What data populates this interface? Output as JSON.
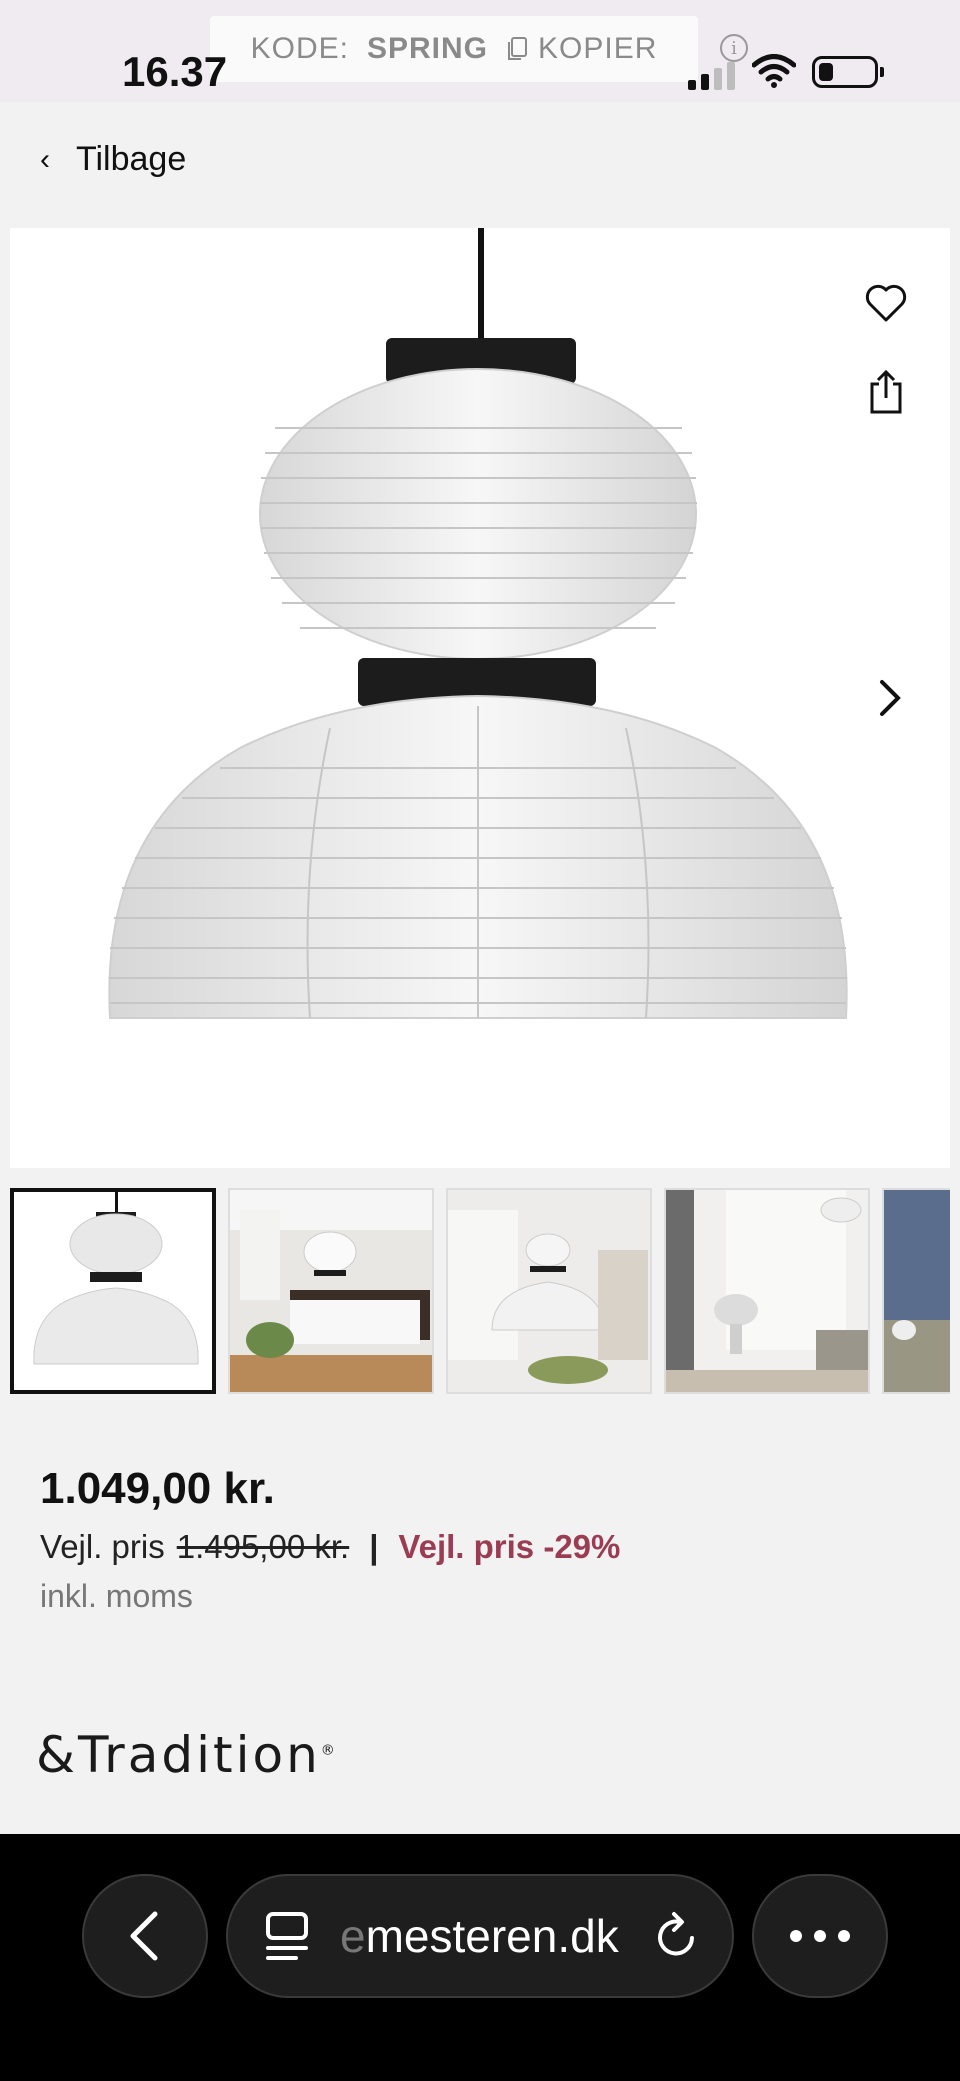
{
  "status_bar": {
    "time": "16.37",
    "promo_label": "KODE:",
    "promo_code": "SPRING",
    "promo_copy": "KOPIER",
    "icons": [
      "info-icon",
      "signal-icon",
      "wifi-icon",
      "battery-icon"
    ]
  },
  "nav": {
    "back_label": "Tilbage"
  },
  "gallery": {
    "icons": [
      "heart-icon",
      "share-icon",
      "chevron-right-icon"
    ],
    "thumbnail_count_visible": 5,
    "active_thumbnail": 1
  },
  "product": {
    "price": "1.049,00 kr.",
    "rrp_label": "Vejl. pris",
    "rrp_value": "1.495,00 kr.",
    "separator": "|",
    "discount": "Vejl. pris -29%",
    "vat_note": "inkl. moms",
    "brand": "&Tradition",
    "brand_mark": "®"
  },
  "browser": {
    "url_prefix": "e",
    "url": "mesteren.dk",
    "icons": [
      "back-arrow-icon",
      "tabs-icon",
      "reload-icon",
      "more-icon"
    ]
  },
  "colors": {
    "status_bg": "#f0eaf1",
    "discount": "#9b3d52",
    "page_bg": "#f2f2f2",
    "browser_bg": "#000000"
  }
}
